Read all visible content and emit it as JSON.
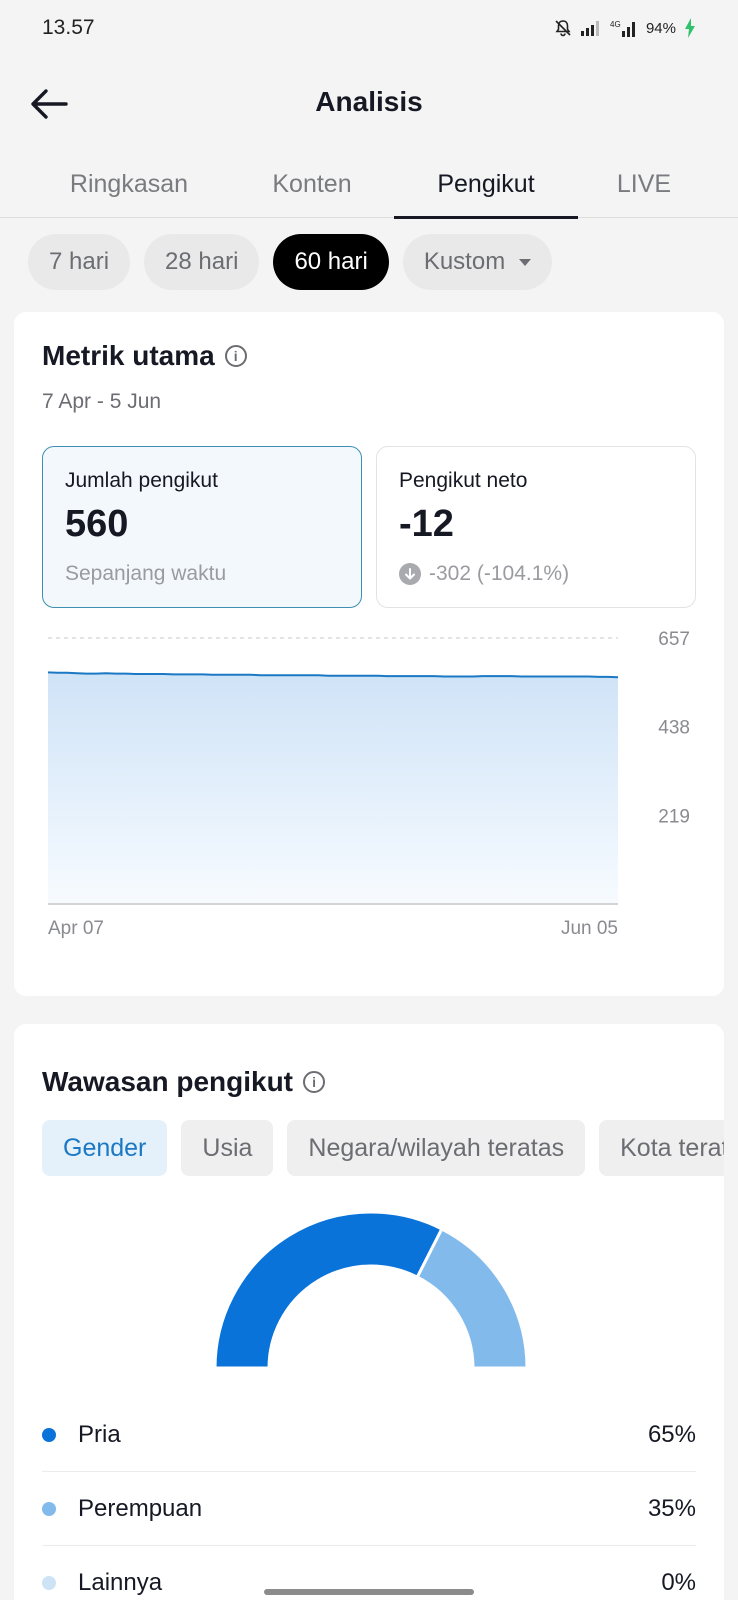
{
  "status_bar": {
    "time": "13.57",
    "battery": "94%"
  },
  "header": {
    "title": "Analisis"
  },
  "tabs": [
    {
      "label": "Ringkasan",
      "active": false
    },
    {
      "label": "Konten",
      "active": false
    },
    {
      "label": "Pengikut",
      "active": true
    },
    {
      "label": "LIVE",
      "active": false
    }
  ],
  "date_ranges": [
    {
      "label": "7 hari",
      "active": false
    },
    {
      "label": "28 hari",
      "active": false
    },
    {
      "label": "60 hari",
      "active": true
    },
    {
      "label": "Kustom",
      "active": false
    }
  ],
  "key_metrics": {
    "title": "Metrik utama",
    "date_range": "7 Apr - 5 Jun",
    "total_followers": {
      "label": "Jumlah pengikut",
      "value": "560",
      "note": "Sepanjang waktu"
    },
    "net_followers": {
      "label": "Pengikut neto",
      "value": "-12",
      "change": "-302 (-104.1%)"
    }
  },
  "chart_data": {
    "type": "area",
    "y_ticks": [
      "657",
      "438",
      "219"
    ],
    "x_ticks": [
      "Apr 07",
      "Jun 05"
    ],
    "ylim": [
      0,
      657
    ],
    "values": [
      572,
      571,
      571,
      570,
      569,
      569,
      570,
      569,
      569,
      568,
      568,
      568,
      568,
      567,
      567,
      567,
      567,
      566,
      566,
      566,
      566,
      566,
      565,
      565,
      565,
      565,
      565,
      565,
      565,
      564,
      564,
      564,
      564,
      564,
      564,
      563,
      563,
      563,
      563,
      563,
      563,
      562,
      562,
      562,
      562,
      563,
      563,
      563,
      563,
      562,
      562,
      562,
      562,
      562,
      562,
      562,
      562,
      561,
      561,
      560
    ],
    "colors": {
      "line": "#1b78c4",
      "fill_top": "#cfe3f7",
      "fill_bottom": "#f7fbff"
    },
    "grid": true
  },
  "follower_insights": {
    "title": "Wawasan pengikut",
    "segments": [
      {
        "label": "Gender",
        "active": true
      },
      {
        "label": "Usia",
        "active": false
      },
      {
        "label": "Negara/wilayah teratas",
        "active": false
      },
      {
        "label": "Kota teratas",
        "active": false
      }
    ],
    "gender": [
      {
        "label": "Pria",
        "value": "65%",
        "percent": 65,
        "color": "#0a73d9"
      },
      {
        "label": "Perempuan",
        "value": "35%",
        "percent": 35,
        "color": "#82bbeb"
      },
      {
        "label": "Lainnya",
        "value": "0%",
        "percent": 0,
        "color": "#cfe3f7"
      }
    ]
  }
}
